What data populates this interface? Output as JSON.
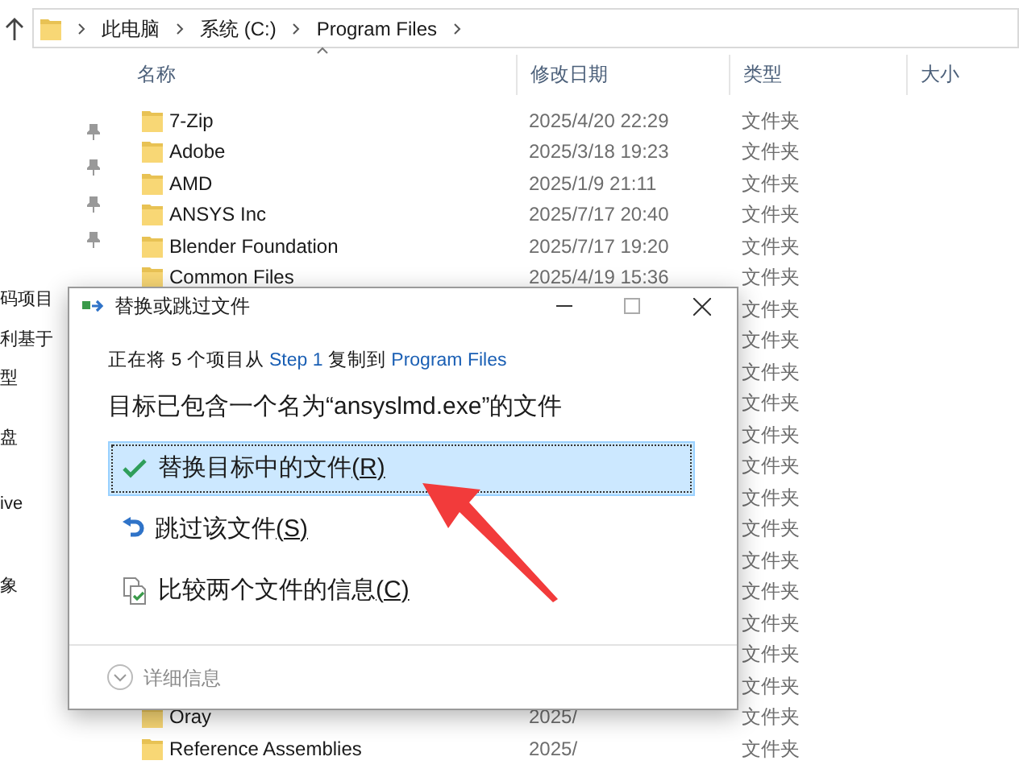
{
  "address_bar": {
    "path": [
      "此电脑",
      "系统 (C:)",
      "Program Files"
    ]
  },
  "nav_pane": {
    "items": [
      "码项目",
      "利基于",
      "型",
      "盘",
      "ive",
      "象"
    ]
  },
  "file_list": {
    "columns": [
      {
        "label": "名称",
        "sorted": true
      },
      {
        "label": "修改日期",
        "sorted": false
      },
      {
        "label": "类型",
        "sorted": false
      },
      {
        "label": "大小",
        "sorted": false
      }
    ],
    "rows": [
      {
        "name": "7-Zip",
        "modified": "2025/4/20 22:29",
        "type": "文件夹"
      },
      {
        "name": "Adobe",
        "modified": "2025/3/18 19:23",
        "type": "文件夹"
      },
      {
        "name": "AMD",
        "modified": "2025/1/9 21:11",
        "type": "文件夹"
      },
      {
        "name": "ANSYS Inc",
        "modified": "2025/7/17 20:40",
        "type": "文件夹"
      },
      {
        "name": "Blender Foundation",
        "modified": "2025/7/17 19:20",
        "type": "文件夹"
      },
      {
        "name": "Common Files",
        "modified": "2025/4/19 15:36",
        "type": "文件夹"
      },
      {
        "type": "文件夹"
      },
      {
        "type": "文件夹"
      },
      {
        "type": "文件夹"
      },
      {
        "type": "文件夹"
      },
      {
        "type": "文件夹"
      },
      {
        "type": "文件夹"
      },
      {
        "type": "文件夹"
      },
      {
        "type": "文件夹"
      },
      {
        "type": "文件夹"
      },
      {
        "type": "文件夹"
      },
      {
        "type": "文件夹"
      },
      {
        "type": "文件夹"
      },
      {
        "type": "文件夹"
      },
      {
        "name": "Oray",
        "modified": "2025/",
        "type": "文件夹"
      },
      {
        "name": "Reference Assemblies",
        "modified": "2025/",
        "type": "文件夹"
      }
    ]
  },
  "dialog": {
    "title": "替换或跳过文件",
    "status": {
      "prefix": "正在将 5 个项目从",
      "source": "Step 1",
      "middle": "复制到",
      "destination": "Program Files"
    },
    "message": "目标已包含一个名为“ansyslmd.exe”的文件",
    "options": [
      {
        "kind": "replace",
        "label": "替换目标中的文件",
        "accesskey": "(R)",
        "selected": true
      },
      {
        "kind": "skip",
        "label": "跳过该文件",
        "accesskey": "(S)",
        "selected": false
      },
      {
        "kind": "compare",
        "label": "比较两个文件的信息",
        "accesskey": "(C)",
        "selected": false
      }
    ],
    "details": "详细信息"
  }
}
